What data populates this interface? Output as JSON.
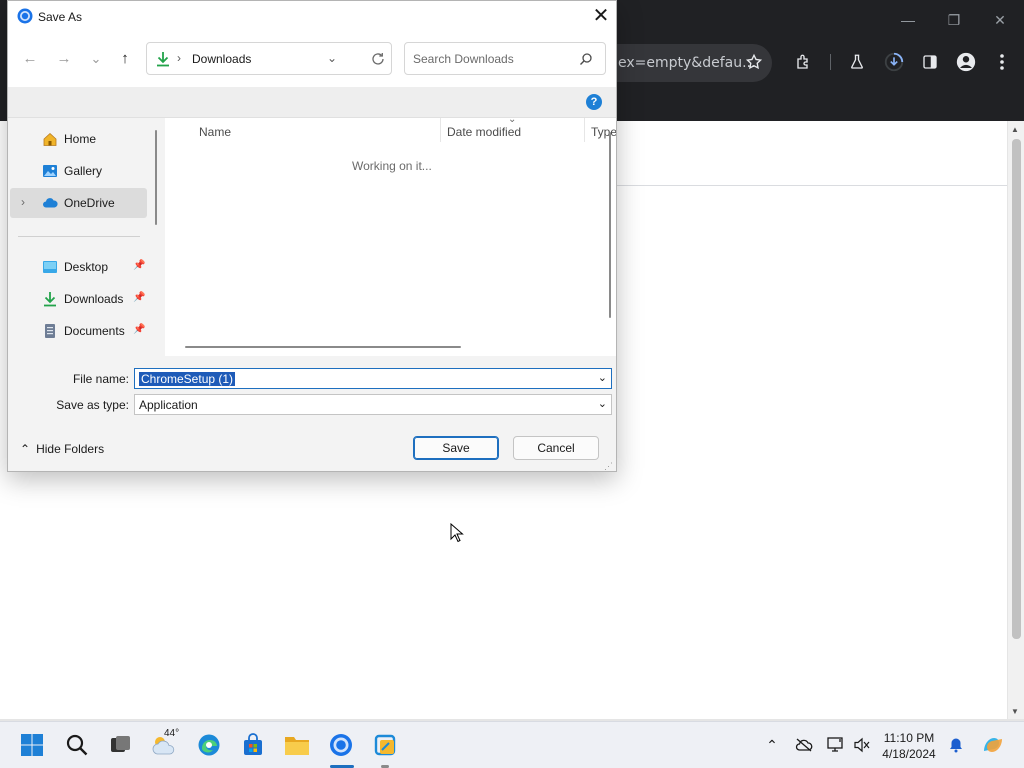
{
  "chrome": {
    "omnibox_text": "ex=empty&defau...",
    "icons": [
      "minimize-icon",
      "restore-icon",
      "close-icon",
      "star-icon",
      "extensions-icon",
      "labs-icon",
      "download-progress-icon",
      "side-panel-icon",
      "profile-icon",
      "menu-icon"
    ]
  },
  "dialog": {
    "title": "Save As",
    "close_glyph": "✕",
    "nav": {
      "back": "←",
      "forward": "→",
      "recent": "⌄",
      "up": "↑"
    },
    "address": {
      "separator": "›",
      "folder": "Downloads"
    },
    "search_placeholder": "Search Downloads",
    "help": "?",
    "sidebar": {
      "items": [
        {
          "label": "Home",
          "icon": "home-icon"
        },
        {
          "label": "Gallery",
          "icon": "gallery-icon"
        },
        {
          "label": "OneDrive",
          "icon": "onedrive-icon",
          "selected": true
        },
        {
          "label": "Desktop",
          "icon": "desktop-icon",
          "pinned": true
        },
        {
          "label": "Downloads",
          "icon": "downloads-icon",
          "pinned": true
        },
        {
          "label": "Documents",
          "icon": "documents-icon",
          "pinned": true
        }
      ]
    },
    "columns": [
      "Name",
      "Date modified",
      "Type"
    ],
    "status_text": "Working on it...",
    "file_name_label": "File name:",
    "file_name_value": "ChromeSetup (1)",
    "save_type_label": "Save as type:",
    "save_type_value": "Application",
    "hide_folders": "Hide Folders",
    "save_button": "Save",
    "cancel_button": "Cancel"
  },
  "taskbar": {
    "weather_temp": "44°",
    "time": "11:10 PM",
    "date": "4/18/2024",
    "apps": [
      "start-icon",
      "search-icon",
      "task-view-icon",
      "weather-icon",
      "edge-icon",
      "store-icon",
      "file-explorer-icon",
      "chrome-icon",
      "snipping-tool-icon"
    ],
    "tray": [
      "chevron-up-icon",
      "onedrive-offline-icon",
      "display-icon",
      "volume-icon",
      "notification-bell-icon",
      "copilot-icon"
    ]
  },
  "colors": {
    "accent": "#1e6fbf",
    "chrome_dark": "#202124",
    "selection": "#1e5bb8"
  }
}
